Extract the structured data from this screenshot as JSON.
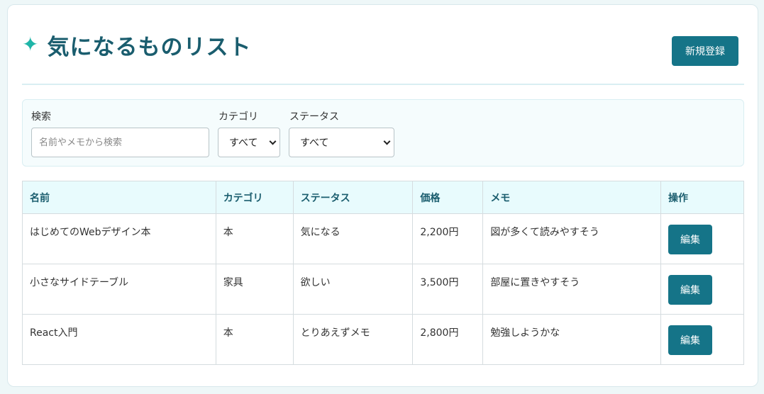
{
  "header": {
    "icon": "sparkle-icon",
    "title": "気になるものリスト",
    "new_button": "新規登録"
  },
  "filters": {
    "search_label": "検索",
    "search_placeholder": "名前やメモから検索",
    "search_value": "",
    "category_label": "カテゴリ",
    "category_value": "すべて",
    "status_label": "ステータス",
    "status_value": "すべて"
  },
  "table": {
    "headers": [
      "名前",
      "カテゴリ",
      "ステータス",
      "価格",
      "メモ",
      "操作"
    ],
    "rows": [
      {
        "name": "はじめてのWebデザイン本",
        "category": "本",
        "status": "気になる",
        "price": "2,200円",
        "memo": "図が多くて読みやすそう",
        "action": "編集"
      },
      {
        "name": "小さなサイドテーブル",
        "category": "家具",
        "status": "欲しい",
        "price": "3,500円",
        "memo": "部屋に置きやすそう",
        "action": "編集"
      },
      {
        "name": "React入門",
        "category": "本",
        "status": "とりあえずメモ",
        "price": "2,800円",
        "memo": "勉強しようかな",
        "action": "編集"
      }
    ]
  },
  "colors": {
    "accent": "#157488",
    "title": "#1a5d6e",
    "sparkle": "#1fb5a8",
    "header_bg": "#e8fbfd"
  }
}
